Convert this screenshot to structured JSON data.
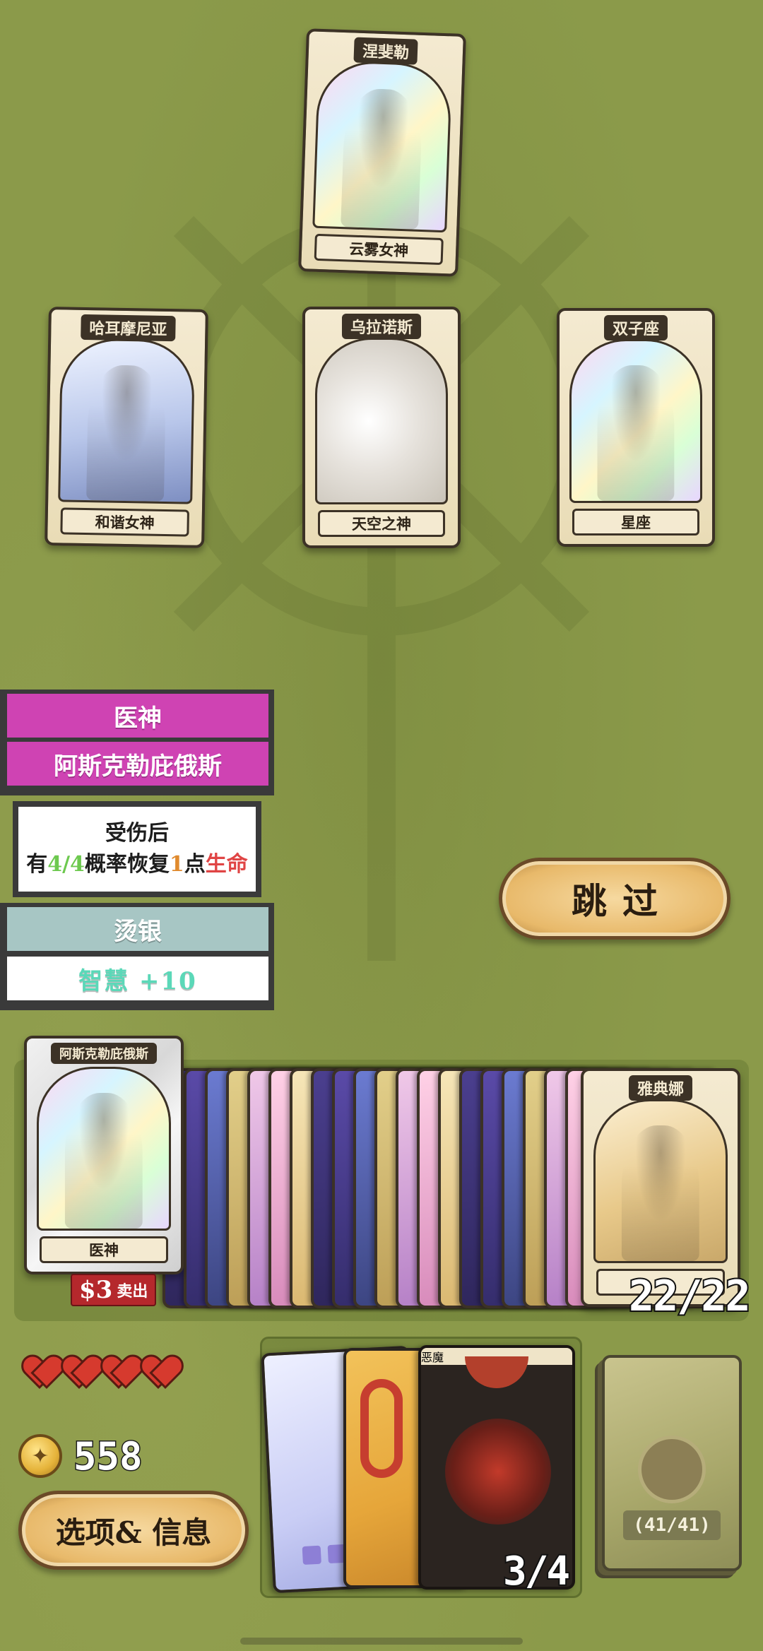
{
  "choice_cards": [
    {
      "name": "涅斐勒",
      "subtitle": "云雾女神"
    },
    {
      "name": "哈耳摩尼亚",
      "subtitle": "和谐女神"
    },
    {
      "name": "乌拉诺斯",
      "subtitle": "天空之神"
    },
    {
      "name": "双子座",
      "subtitle": "星座"
    }
  ],
  "selected_info": {
    "category": "医神",
    "name": "阿斯克勒庇俄斯",
    "effect_line1": "受伤后",
    "effect_prefix": "有",
    "effect_chance": "4/4",
    "effect_mid": "概率恢复",
    "effect_amount": "1",
    "effect_unit": "点",
    "effect_stat": "生命",
    "enhancement": "烫银",
    "bonus": "智慧 +10"
  },
  "skip_button": {
    "label": "跳过"
  },
  "hand": {
    "selected_card_name": "阿斯克勒庇俄斯",
    "selected_card_subtitle": "医神",
    "sell_price": "$3",
    "sell_label": "卖出",
    "last_card_name": "雅典娜",
    "count": "22/22"
  },
  "player": {
    "hearts": 4,
    "coins": "558",
    "options_label": "选项& 信息"
  },
  "consumables": {
    "cards": [
      {
        "name": ""
      },
      {
        "name": ""
      },
      {
        "name": "恶魔"
      }
    ],
    "count": "3/4"
  },
  "deck": {
    "count": "(41/41)"
  },
  "colors": {
    "background": "#8b9a4a",
    "magenta": "#cf43b3",
    "teal": "#a7c6c4",
    "bonus_text": "#5bd8b8",
    "button_gold": "#e8b96a"
  }
}
